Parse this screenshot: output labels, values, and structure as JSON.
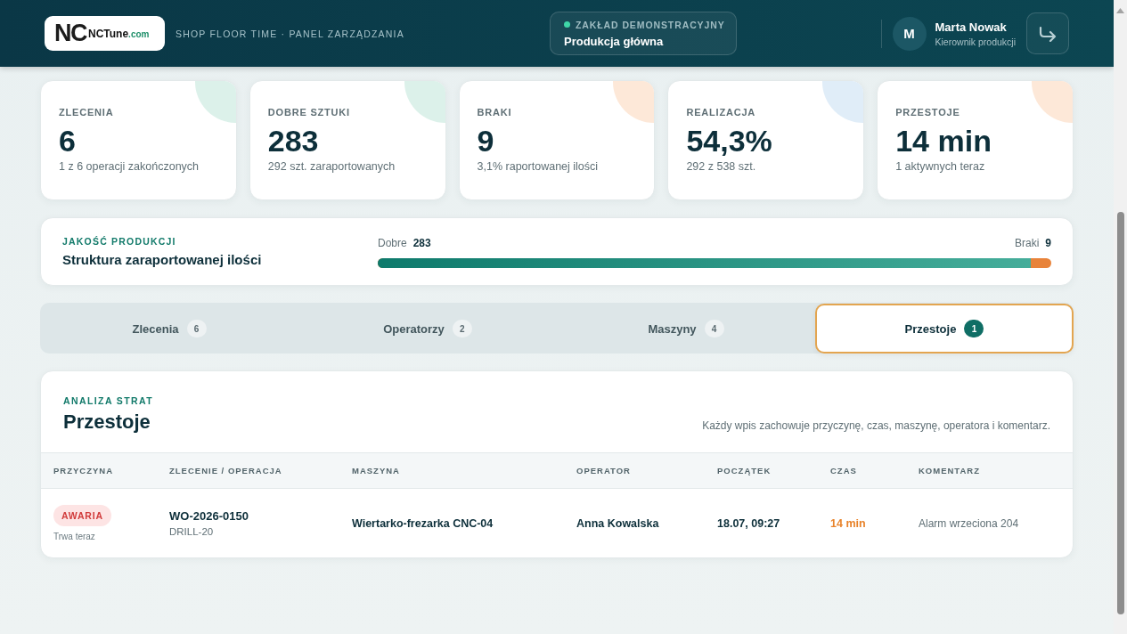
{
  "header": {
    "logo": {
      "mark": "NC",
      "name": "NCTune",
      "suffix": ".com"
    },
    "subtitle": "SHOP FLOOR TIME · PANEL ZARZĄDZANIA",
    "plant": {
      "label": "ZAKŁAD DEMONSTRACYJNY",
      "name": "Produkcja główna"
    },
    "user": {
      "initial": "M",
      "name": "Marta Nowak",
      "role": "Kierownik produkcji"
    }
  },
  "stats": [
    {
      "label": "ZLECENIA",
      "value": "6",
      "note": "1 z 6 operacji zakończonych",
      "color": "#dcf1ea"
    },
    {
      "label": "DOBRE SZTUKI",
      "value": "283",
      "note": "292 szt. zaraportowanych",
      "color": "#dcf1ea"
    },
    {
      "label": "BRAKI",
      "value": "9",
      "note": "3,1% raportowanej ilości",
      "color": "#fde8d8"
    },
    {
      "label": "REALIZACJA",
      "value": "54,3%",
      "note": "292 z 538 szt.",
      "color": "#e0edf8"
    },
    {
      "label": "PRZESTOJE",
      "value": "14 min",
      "note": "1 aktywnych teraz",
      "color": "#fde8d8"
    }
  ],
  "quality": {
    "eyebrow": "JAKOŚĆ PRODUKCJI",
    "title": "Struktura zaraportowanej ilości",
    "good_label": "Dobre",
    "good_value": "283",
    "scrap_label": "Braki",
    "scrap_value": "9",
    "level": 0.969
  },
  "tabs": [
    {
      "label": "Zlecenia",
      "count": "6",
      "selected": false
    },
    {
      "label": "Operatorzy",
      "count": "2",
      "selected": false
    },
    {
      "label": "Maszyny",
      "count": "4",
      "selected": false
    },
    {
      "label": "Przestoje",
      "count": "1",
      "selected": true
    }
  ],
  "downtime": {
    "eyebrow": "ANALIZA STRAT",
    "title": "Przestoje",
    "description": "Każdy wpis zachowuje przyczynę, czas, maszynę, operatora i komentarz.",
    "table": {
      "columns": [
        "PRZYCZYNA",
        "ZLECENIE / OPERACJA",
        "MASZYNA",
        "OPERATOR",
        "POCZĄTEK",
        "CZAS",
        "KOMENTARZ"
      ],
      "rows": [
        {
          "reason": {
            "label": "AWARIA",
            "kind": "breakdown"
          },
          "status": "Trwa teraz",
          "order": "WO-2026-0150",
          "operation": "DRILL-20",
          "machine": "Wiertarko-frezarka CNC-04",
          "operator": "Anna Kowalska",
          "start": "18.07, 09:27",
          "duration": "14 min",
          "active": true,
          "comment": "Alarm wrzeciona 204"
        }
      ]
    }
  }
}
